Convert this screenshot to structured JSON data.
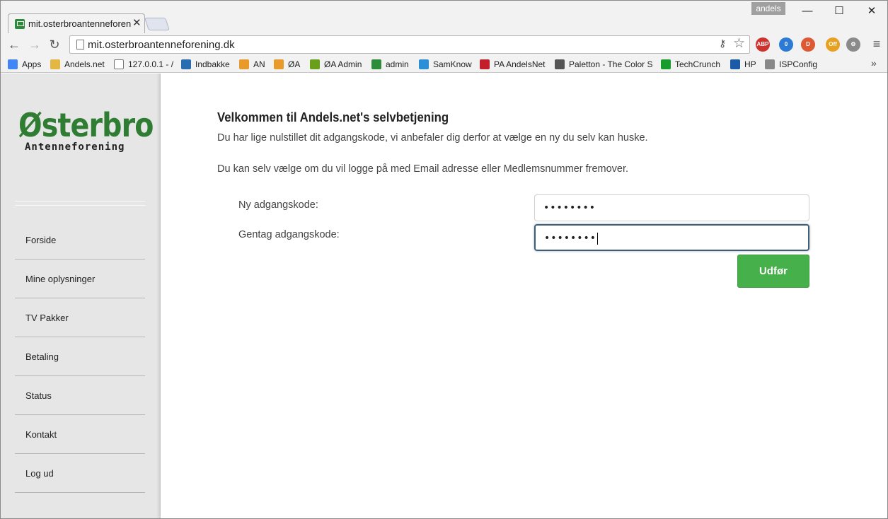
{
  "browser": {
    "tab_title": "mit.osterbroantenneforeni",
    "profile_name": "andels",
    "url": "mit.osterbroantenneforening.dk",
    "window_controls": {
      "minimize": "—",
      "maximize": "☐",
      "close": "✕"
    },
    "nav": {
      "back": "←",
      "forward": "→",
      "reload": "↻"
    },
    "extensions": [
      {
        "name": "adblock-plus-icon",
        "label": "ABP",
        "color": "#d0312d"
      },
      {
        "name": "ghostery-icon",
        "label": "0",
        "color": "#2a7ad6"
      },
      {
        "name": "duckduckgo-icon",
        "label": "D",
        "color": "#de5833"
      },
      {
        "name": "off-extension-icon",
        "label": "Off",
        "color": "#e8a020"
      },
      {
        "name": "settings-extension-icon",
        "label": "⚙",
        "color": "#8a8a8a"
      }
    ]
  },
  "bookmarks": [
    {
      "label": "Apps",
      "icon": "apps-grid-icon",
      "color": "#4285f4"
    },
    {
      "label": "Andels.net",
      "icon": "folder-icon",
      "color": "#e4b642"
    },
    {
      "label": "127.0.0.1 - /",
      "icon": "page-icon",
      "color": "#ffffff"
    },
    {
      "label": "Indbakke",
      "icon": "inbox-icon",
      "color": "#2a6cb0"
    },
    {
      "label": "AN",
      "icon": "pma-icon",
      "color": "#e89b2a"
    },
    {
      "label": "ØA",
      "icon": "pma-icon",
      "color": "#e89b2a"
    },
    {
      "label": "ØA Admin",
      "icon": "admin-circle-icon",
      "color": "#6a9f1a"
    },
    {
      "label": "admin",
      "icon": "admin-box-icon",
      "color": "#2b8d3c"
    },
    {
      "label": "SamKnow",
      "icon": "samknows-icon",
      "color": "#2a8fd6"
    },
    {
      "label": "PA AndelsNet",
      "icon": "pa-icon",
      "color": "#c21f2d"
    },
    {
      "label": "Paletton - The Color S",
      "icon": "paletton-icon",
      "color": "#555555"
    },
    {
      "label": "TechCrunch",
      "icon": "techcrunch-icon",
      "color": "#1a9b2e"
    },
    {
      "label": "HP",
      "icon": "hp-icon",
      "color": "#1b5aa6"
    },
    {
      "label": "ISPConfig",
      "icon": "tools-icon",
      "color": "#888888"
    }
  ],
  "sidebar": {
    "logo_main": "Østerbro",
    "logo_sub": "Antenneforening",
    "nav_items": [
      {
        "label": "Forside"
      },
      {
        "label": "Mine oplysninger"
      },
      {
        "label": "TV Pakker"
      },
      {
        "label": "Betaling"
      },
      {
        "label": "Status"
      },
      {
        "label": "Kontakt"
      },
      {
        "label": "Log ud"
      }
    ]
  },
  "main": {
    "heading": "Velkommen til Andels.net's selvbetjening",
    "intro": "Du har lige nulstillet dit adgangskode, vi anbefaler dig derfor at vælge en ny du selv kan huske.",
    "intro2": "Du kan selv vælge om du vil logge på med Email adresse eller Medlemsnummer fremover.",
    "form": {
      "new_password_label": "Ny adgangskode:",
      "new_password_value": "••••••••",
      "repeat_password_label": "Gentag adgangskode:",
      "repeat_password_value": "••••••••",
      "submit_label": "Udfør"
    }
  },
  "colors": {
    "brand_green": "#2e7d32",
    "button_green": "#46b04a",
    "sidebar_bg": "#e6e6e6",
    "focus_border": "#3f5f78"
  }
}
